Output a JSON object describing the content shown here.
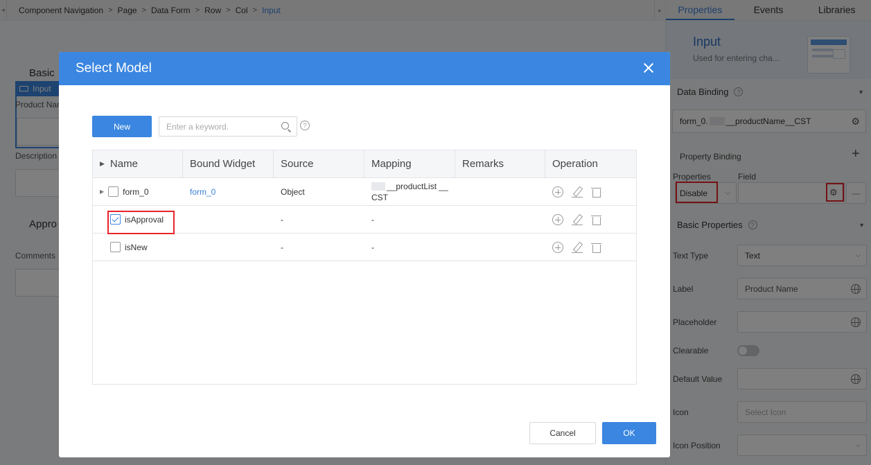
{
  "breadcrumb": [
    "Component Navigation",
    "Page",
    "Data Form",
    "Row",
    "Col"
  ],
  "breadcrumb_current": "Input",
  "background": {
    "basic_heading": "Basic",
    "input_tag": "Input",
    "product_label": "Product Nar",
    "description_label": "Description",
    "approval_heading": "Appro",
    "comments_label": "Comments"
  },
  "panel": {
    "tabs": [
      "Properties",
      "Events",
      "Libraries"
    ],
    "banner_title": "Input",
    "banner_desc": "Used for entering cha...",
    "data_binding": {
      "title": "Data Binding",
      "value_prefix": "form_0.",
      "value_suffix": "__productName__CST"
    },
    "property_binding": {
      "title": "Property Binding",
      "properties_label": "Properties",
      "field_label": "Field",
      "property_value": "Disable"
    },
    "basic": {
      "title": "Basic Properties",
      "text_type_label": "Text Type",
      "text_type_value": "Text",
      "label_label": "Label",
      "label_value": "Product Name",
      "placeholder_label": "Placeholder",
      "clearable_label": "Clearable",
      "default_label": "Default Value",
      "icon_label": "Icon",
      "icon_placeholder": "Select Icon",
      "icon_position_label": "Icon Position"
    }
  },
  "modal": {
    "title": "Select Model",
    "new_label": "New",
    "search_placeholder": "Enter a keyword.",
    "help_glyph": "?",
    "columns": [
      "Name",
      "Bound Widget",
      "Source",
      "Mapping",
      "Remarks",
      "Operation"
    ],
    "rows": [
      {
        "name": "form_0",
        "bound": "form_0",
        "source": "Object",
        "mapping_a": "__productList __",
        "mapping_b": "CST",
        "checked": false
      },
      {
        "name": "isApproval",
        "bound": "",
        "source": "-",
        "mapping_a": "-",
        "mapping_b": "",
        "checked": true
      },
      {
        "name": "isNew",
        "bound": "",
        "source": "-",
        "mapping_a": "-",
        "mapping_b": "",
        "checked": false
      }
    ],
    "cancel_label": "Cancel",
    "ok_label": "OK"
  },
  "colors": {
    "accent": "#3a86e0",
    "highlight": "#e8242b"
  },
  "icons": [
    "close-icon",
    "search-icon",
    "help-icon",
    "add-icon",
    "edit-icon",
    "delete-icon",
    "gear-icon",
    "globe-icon",
    "chevron-down-icon",
    "expand-arrow-icon"
  ]
}
